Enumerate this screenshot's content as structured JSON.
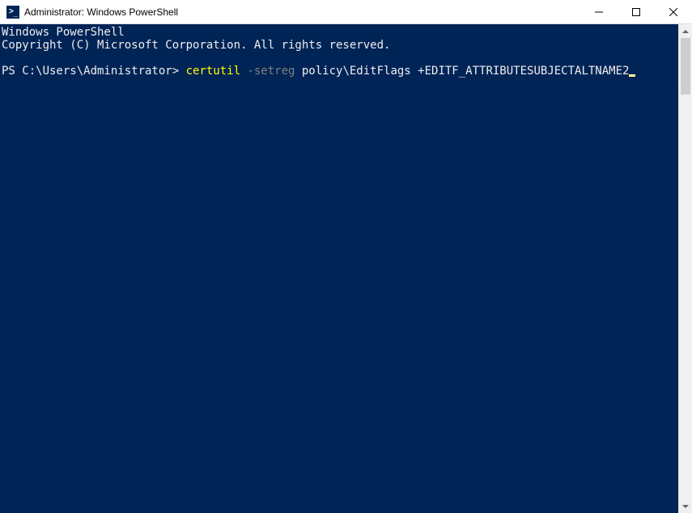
{
  "titlebar": {
    "title": "Administrator: Windows PowerShell"
  },
  "terminal": {
    "header_line1": "Windows PowerShell",
    "header_line2": "Copyright (C) Microsoft Corporation. All rights reserved.",
    "prompt": "PS C:\\Users\\Administrator> ",
    "cmd_executable": "certutil ",
    "cmd_param": "-setreg ",
    "cmd_args": "policy\\EditFlags +EDITF_ATTRIBUTESUBJECTALTNAME2"
  }
}
